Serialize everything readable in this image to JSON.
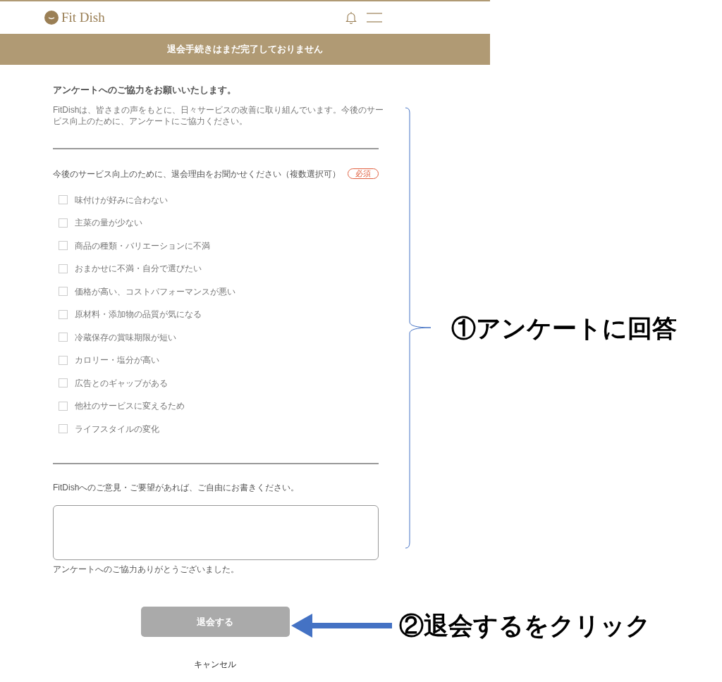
{
  "header": {
    "logo": "Fit Dish"
  },
  "banner": "退会手続きはまだ完了しておりません",
  "survey": {
    "heading": "アンケートへのご協力をお願いいたします。",
    "intro": "FitDishは、皆さまの声をもとに、日々サービスの改善に取り組んでいます。今後のサービス向上のために、アンケートにご協力ください。",
    "question": "今後のサービス向上のために、退会理由をお聞かせください（複数選択可）",
    "required_badge": "必須",
    "options": [
      {
        "label": "味付けが好みに合わない",
        "checked": false
      },
      {
        "label": "主菜の量が少ない",
        "checked": false
      },
      {
        "label": "商品の種類・バリエーションに不満",
        "checked": false
      },
      {
        "label": "おまかせに不満・自分で選びたい",
        "checked": false
      },
      {
        "label": "価格が高い、コストパフォーマンスが悪い",
        "checked": false
      },
      {
        "label": "原材料・添加物の品質が気になる",
        "checked": false
      },
      {
        "label": "冷蔵保存の賞味期限が短い",
        "checked": false
      },
      {
        "label": "カロリー・塩分が高い",
        "checked": false
      },
      {
        "label": "広告とのギャップがある",
        "checked": false
      },
      {
        "label": "他社のサービスに変えるため",
        "checked": false
      },
      {
        "label": "ライフスタイルの変化",
        "checked": false
      }
    ],
    "comment_label": "FitDishへのご意見・ご要望があれば、ご自由にお書きください。",
    "thanks": "アンケートへのご協力ありがとうございました。"
  },
  "submit_button": {
    "label": "退会する",
    "disabled": true
  },
  "cancel_link": "キャンセル",
  "annotations": [
    {
      "kind": "bracket",
      "text": "①アンケートに回答"
    },
    {
      "kind": "arrow",
      "text": "②退会するをクリック"
    }
  ]
}
